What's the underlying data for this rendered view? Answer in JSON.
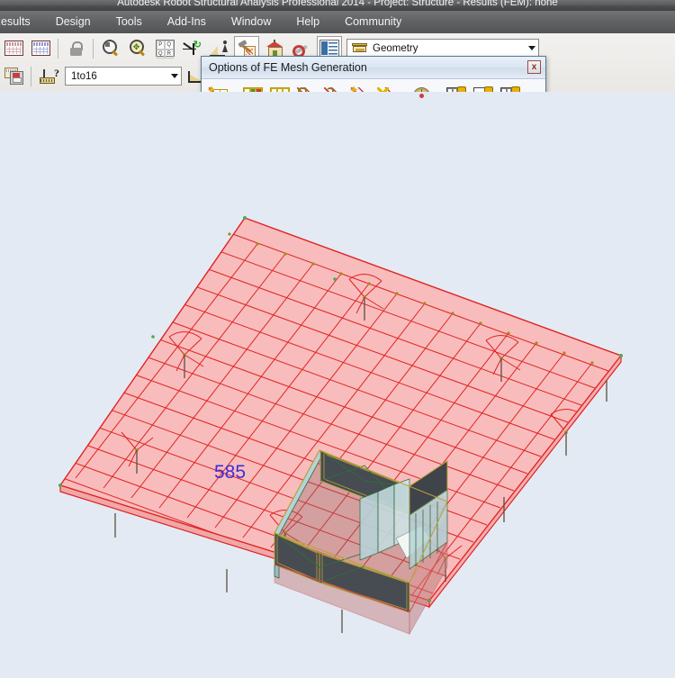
{
  "window": {
    "title": "Autodesk Robot Structural Analysis Professional 2014 - Project: Structure - Results (FEM): none"
  },
  "menubar": {
    "items": [
      {
        "label": "Results",
        "name": "menu-results"
      },
      {
        "label": "Design",
        "name": "menu-design"
      },
      {
        "label": "Tools",
        "name": "menu-tools"
      },
      {
        "label": "Add-Ins",
        "name": "menu-add-ins"
      },
      {
        "label": "Window",
        "name": "menu-window"
      },
      {
        "label": "Help",
        "name": "menu-help"
      },
      {
        "label": "Community",
        "name": "menu-community"
      }
    ]
  },
  "toolbar_row1": {
    "buttons": [
      {
        "name": "tables-red-button",
        "icon": "table-red-icon"
      },
      {
        "name": "tables-blue-button",
        "icon": "table-blue-icon"
      },
      {
        "name": "lock-button",
        "icon": "lock-icon"
      },
      {
        "name": "zoom-window-button",
        "icon": "magnifier-icon"
      },
      {
        "name": "pan-zoom-button",
        "icon": "magnifier-pan-icon"
      },
      {
        "name": "view-quad-button",
        "icon": "four-views-icon"
      },
      {
        "name": "local-axis-button",
        "icon": "axis-green-icon"
      },
      {
        "name": "supports-display-button",
        "icon": "beam-support-icon"
      },
      {
        "name": "structure-model-button",
        "icon": "hammer-icon"
      },
      {
        "name": "rendered-view-button",
        "icon": "house-icon"
      },
      {
        "name": "preferences-button",
        "icon": "wrench-icon"
      },
      {
        "name": "display-settings-button",
        "icon": "list-view-icon"
      }
    ]
  },
  "toolbar_row2": {
    "buttons": [
      {
        "name": "save-structure-button",
        "icon": "save-building-icon"
      },
      {
        "name": "support-query-button",
        "icon": "support-question-icon"
      },
      {
        "name": "diagram-query-button",
        "icon": "diagram-question-icon"
      }
    ],
    "case_combo": {
      "name": "load-case-combo",
      "value": "1to16"
    }
  },
  "view_combo": {
    "name": "display-mode-combo",
    "value": "Geometry",
    "icon": "geometry-icon"
  },
  "dialog": {
    "title": "Options of FE Mesh Generation",
    "close_label": "x",
    "buttons": [
      {
        "name": "mesh-generation-options-button",
        "icon": "mesh-star-icon"
      },
      {
        "name": "mesh-numbering-button",
        "icon": "mesh-numbered-grid-icon"
      },
      {
        "name": "mesh-freeze-button",
        "icon": "mesh-grid-cross-icon"
      },
      {
        "name": "mesh-lock-button",
        "icon": "mesh-lock-closed-icon"
      },
      {
        "name": "mesh-unlock-button",
        "icon": "mesh-lock-open-icon"
      },
      {
        "name": "mesh-generate-button",
        "icon": "mesh-star-red-icon"
      },
      {
        "name": "mesh-delete-button",
        "icon": "mesh-x-red-icon"
      },
      {
        "name": "mesh-local-direction-button",
        "icon": "target-disc-icon"
      },
      {
        "name": "panel-mesh-grid-button",
        "icon": "panel-grid-hand-icon"
      },
      {
        "name": "panel-mesh-plain-button",
        "icon": "panel-plain-hand-icon"
      },
      {
        "name": "panel-mesh-mixed-button",
        "icon": "panel-mixed-hand-icon"
      }
    ]
  },
  "viewport": {
    "node_label": "585",
    "colors": {
      "background": "#e3eaf4",
      "slab_fill": "#f7b9b9",
      "mesh_line": "#e02222",
      "node_marker": "#8a8a1a",
      "wall_dark": "#4a4e55",
      "wall_glass": "#b9d3d8",
      "wall_outline": "#b8a33a",
      "label_color": "#3a2fd8"
    }
  }
}
